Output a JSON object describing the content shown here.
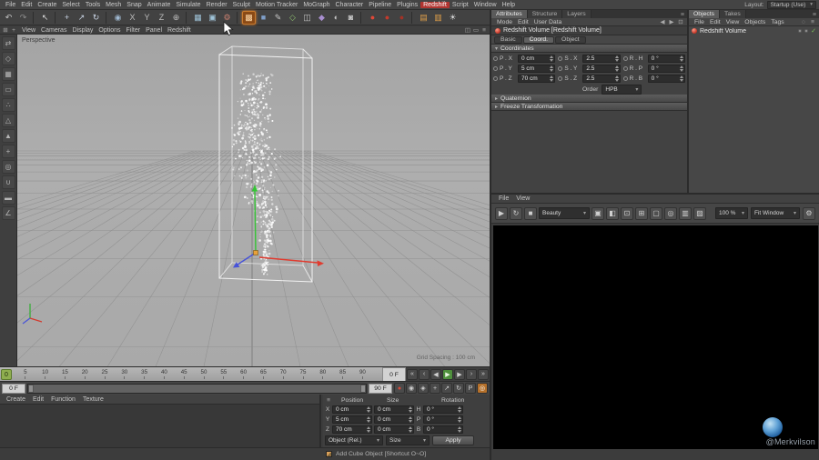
{
  "menu_bar": {
    "items": [
      "File",
      "Edit",
      "Create",
      "Select",
      "Tools",
      "Mesh",
      "Snap",
      "Animate",
      "Simulate",
      "Render",
      "Sculpt",
      "Motion Tracker",
      "MoGraph",
      "Character",
      "Pipeline",
      "Plugins",
      "Redshift",
      "Script",
      "Window",
      "Help"
    ],
    "highlight": "Redshift",
    "layout_label": "Layout:",
    "layout_value": "Startup (Use)"
  },
  "toolbar": {
    "icons": [
      {
        "name": "undo-icon",
        "glyph": "↶",
        "fg": "#c6c6c6"
      },
      {
        "name": "redo-icon",
        "glyph": "↷",
        "fg": "#8f8f8f"
      },
      {
        "sep": true
      },
      {
        "name": "live-selection-icon",
        "glyph": "↖",
        "fg": "#dcdcdc"
      },
      {
        "sep": true
      },
      {
        "name": "move-icon",
        "glyph": "+",
        "fg": "#c9d4e4"
      },
      {
        "name": "scale-icon",
        "glyph": "↗",
        "fg": "#c9d4e4"
      },
      {
        "name": "rotate-icon",
        "glyph": "↻",
        "fg": "#c9d4e4"
      },
      {
        "sep": true
      },
      {
        "name": "last-tool-icon",
        "glyph": "◉",
        "fg": "#9fb8d0"
      },
      {
        "name": "lock-x-axis-icon",
        "glyph": "X",
        "fg": "#bcbcbc"
      },
      {
        "name": "lock-y-axis-icon",
        "glyph": "Y",
        "fg": "#bcbcbc"
      },
      {
        "name": "lock-z-axis-icon",
        "glyph": "Z",
        "fg": "#bcbcbc"
      },
      {
        "name": "coordinate-system-icon",
        "glyph": "⊕",
        "fg": "#bcbcbc"
      },
      {
        "sep": true
      },
      {
        "name": "render-view-icon",
        "glyph": "▦",
        "fg": "#9fc3d8"
      },
      {
        "name": "render-picture-viewer-icon",
        "glyph": "▣",
        "fg": "#9fc3d8"
      },
      {
        "name": "render-settings-icon",
        "glyph": "⚙",
        "fg": "#c87f6f"
      },
      {
        "sep": true
      },
      {
        "name": "volume-builder-icon",
        "glyph": "▩",
        "fg": "#ffd9a8",
        "hl": true
      },
      {
        "name": "primitive-cube-icon",
        "glyph": "■",
        "fg": "#7f9fc9"
      },
      {
        "name": "spline-pen-icon",
        "glyph": "✎",
        "fg": "#c6c6c6"
      },
      {
        "name": "subdivision-surface-icon",
        "glyph": "◇",
        "fg": "#8fc06f"
      },
      {
        "name": "symmetry-icon",
        "glyph": "◫",
        "fg": "#c6c6c6"
      },
      {
        "name": "deformer-icon",
        "glyph": "◆",
        "fg": "#a98fd0"
      },
      {
        "name": "environment-icon",
        "glyph": "◐",
        "fg": "#c6c6c6"
      },
      {
        "name": "camera-icon",
        "glyph": "◙",
        "fg": "#c6c6c6"
      },
      {
        "sep": true
      },
      {
        "name": "redshift-renderview-icon",
        "glyph": "●",
        "fg": "#e04838"
      },
      {
        "name": "redshift-ipr-icon",
        "glyph": "●",
        "fg": "#c43a2c"
      },
      {
        "name": "redshift-settings-icon",
        "glyph": "●",
        "fg": "#a33226"
      },
      {
        "sep": true
      },
      {
        "name": "redshift-proxy-icon",
        "glyph": "▤",
        "fg": "#e0a04a"
      },
      {
        "name": "redshift-volume-icon",
        "glyph": "▥",
        "fg": "#e0a04a"
      },
      {
        "name": "redshift-light-icon",
        "glyph": "☀",
        "fg": "#dcdcdc"
      }
    ]
  },
  "viewport_bar": {
    "left_icons": [
      {
        "name": "viewport-grid-icon",
        "glyph": "⊞"
      },
      {
        "name": "viewport-axis-icon",
        "glyph": "+"
      }
    ],
    "items": [
      "View",
      "Cameras",
      "Display",
      "Options",
      "Filter",
      "Panel",
      "Redshift"
    ],
    "right_icons": [
      {
        "name": "viewport-layout-icon",
        "glyph": "◫"
      },
      {
        "name": "viewport-maximize-icon",
        "glyph": "▭"
      },
      {
        "name": "viewport-menu-icon",
        "glyph": "≡"
      }
    ]
  },
  "left_palette": {
    "icons": [
      {
        "name": "make-editable-icon",
        "glyph": "⇄"
      },
      {
        "name": "model-mode-icon",
        "glyph": "◇"
      },
      {
        "name": "texture-mode-icon",
        "glyph": "▦"
      },
      {
        "name": "workplane-mode-icon",
        "glyph": "▭"
      },
      {
        "name": "points-mode-icon",
        "glyph": "∴"
      },
      {
        "name": "edges-mode-icon",
        "glyph": "△"
      },
      {
        "name": "polygons-mode-icon",
        "glyph": "▲"
      },
      {
        "name": "enable-axis-icon",
        "glyph": "+"
      },
      {
        "name": "viewport-solo-icon",
        "glyph": "◎"
      },
      {
        "name": "snap-icon",
        "glyph": "∪"
      },
      {
        "name": "workplane-lock-icon",
        "glyph": "▬"
      },
      {
        "name": "quantize-icon",
        "glyph": "∠"
      }
    ]
  },
  "viewport": {
    "label": "Perspective",
    "grid_spacing": "Grid Spacing : 100 cm"
  },
  "timeline": {
    "ticks": [
      "0",
      "5",
      "10",
      "15",
      "20",
      "25",
      "30",
      "35",
      "40",
      "45",
      "50",
      "55",
      "60",
      "65",
      "70",
      "75",
      "80",
      "85",
      "90"
    ],
    "marker": "0",
    "frame_field": "0 F",
    "transport": [
      {
        "name": "goto-start-button",
        "glyph": "«"
      },
      {
        "name": "prev-key-button",
        "glyph": "‹"
      },
      {
        "name": "prev-frame-button",
        "glyph": "◀"
      },
      {
        "name": "play-button",
        "glyph": "▶",
        "bg": "#4e8f3c",
        "fg": "#eaf6e2"
      },
      {
        "name": "next-frame-button",
        "glyph": "▶"
      },
      {
        "name": "next-key-button",
        "glyph": "›"
      },
      {
        "name": "goto-end-button",
        "glyph": "»"
      }
    ]
  },
  "rangebar": {
    "start": "0 F",
    "end": "90 F",
    "key_icons": [
      {
        "name": "record-keyframe-icon",
        "glyph": "●",
        "fg": "#d84a3a"
      },
      {
        "name": "autokey-icon",
        "glyph": "◉",
        "fg": "#cfcfcf"
      },
      {
        "name": "keyframe-selection-icon",
        "glyph": "◈",
        "fg": "#cfcfcf"
      },
      {
        "name": "key-position-icon",
        "glyph": "+",
        "fg": "#cfcfcf"
      },
      {
        "name": "key-scale-icon",
        "glyph": "↗",
        "fg": "#cfcfcf"
      },
      {
        "name": "key-rotation-icon",
        "glyph": "↻",
        "fg": "#cfcfcf"
      },
      {
        "name": "key-parameter-icon",
        "glyph": "P",
        "fg": "#cfcfcf"
      },
      {
        "name": "solo-icon",
        "glyph": "◎",
        "fg": "#ffffff",
        "bg": "#b5702a"
      }
    ]
  },
  "materials": {
    "menu": [
      "Create",
      "Edit",
      "Function",
      "Texture"
    ]
  },
  "coords_manager": {
    "menu_icon": "≡",
    "headers": [
      "Position",
      "Size",
      "Rotation"
    ],
    "rows": [
      {
        "axis": "X",
        "pos": "0 cm",
        "size": "0 cm",
        "rot_axis": "H",
        "rot": "0 °"
      },
      {
        "axis": "Y",
        "pos": "5 cm",
        "size": "0 cm",
        "rot_axis": "P",
        "rot": "0 °"
      },
      {
        "axis": "Z",
        "pos": "70 cm",
        "size": "0 cm",
        "rot_axis": "B",
        "rot": "0 °"
      }
    ],
    "mode_dropdown": "Object (Rel.)",
    "size_dropdown": "Size",
    "apply_label": "Apply"
  },
  "status_bar": {
    "text": "Add Cube Object [Shortcut O~O]"
  },
  "attributes": {
    "tabs": [
      "Attributes",
      "Structure",
      "Layers"
    ],
    "active_tab": "Attributes",
    "menu": [
      "Mode",
      "Edit",
      "User Data"
    ],
    "menu_icons": [
      {
        "name": "attr-back-icon",
        "glyph": "◀"
      },
      {
        "name": "attr-forward-icon",
        "glyph": "▶"
      },
      {
        "name": "attr-lock-icon",
        "glyph": "⊡"
      }
    ],
    "object_title": "Redshift Volume [Redshift Volume]",
    "subtabs": [
      "Basic",
      "Coord.",
      "Object"
    ],
    "active_subtab": "Coord.",
    "section": "Coordinates",
    "coord_rows": [
      {
        "cells": [
          {
            "label": "P . X",
            "value": "0 cm"
          },
          {
            "label": "S . X",
            "value": "2.5"
          },
          {
            "label": "R . H",
            "value": "0 °"
          }
        ]
      },
      {
        "cells": [
          {
            "label": "P . Y",
            "value": "5 cm"
          },
          {
            "label": "S . Y",
            "value": "2.5"
          },
          {
            "label": "R . P",
            "value": "0 °"
          }
        ]
      },
      {
        "cells": [
          {
            "label": "P . Z",
            "value": "70 cm"
          },
          {
            "label": "S . Z",
            "value": "2.5"
          },
          {
            "label": "R . B",
            "value": "0 °"
          }
        ]
      }
    ],
    "order_label": "Order",
    "order_value": "HPB",
    "collapsed_sections": [
      "Quaternion",
      "Freeze Transformation"
    ]
  },
  "objects": {
    "tabs": [
      "Objects",
      "Takes"
    ],
    "active_tab": "Objects",
    "menu": [
      "File",
      "Edit",
      "View",
      "Objects",
      "Tags"
    ],
    "menu_icons": [
      {
        "name": "objects-search-icon",
        "glyph": "◌"
      },
      {
        "name": "objects-filter-icon",
        "glyph": "≡"
      }
    ],
    "items": [
      {
        "label": "Redshift Volume",
        "check": "✓"
      }
    ]
  },
  "renderview": {
    "menu": [
      "File",
      "View"
    ],
    "left_icons": [
      {
        "name": "rv-render-icon",
        "glyph": "▶"
      },
      {
        "name": "rv-ipr-icon",
        "glyph": "↻"
      },
      {
        "name": "rv-abort-icon",
        "glyph": "■"
      }
    ],
    "beauty_dropdown": "Beauty",
    "mid_icons": [
      {
        "name": "rv-snapshot-icon",
        "glyph": "▣"
      },
      {
        "name": "rv-compare-icon",
        "glyph": "◧"
      },
      {
        "name": "rv-lock-icon",
        "glyph": "⊡"
      },
      {
        "name": "rv-grid-icon",
        "glyph": "⊞"
      },
      {
        "name": "rv-region-icon",
        "glyph": "▢"
      },
      {
        "name": "rv-probe-icon",
        "glyph": "◎"
      },
      {
        "name": "rv-swatch-icon",
        "glyph": "▥"
      },
      {
        "name": "rv-background-icon",
        "glyph": "▨"
      }
    ],
    "zoom_dropdown": "100 %",
    "fit_dropdown": "Fit Window",
    "gear_icon": "⚙",
    "watermark": "@Merkvilson"
  }
}
